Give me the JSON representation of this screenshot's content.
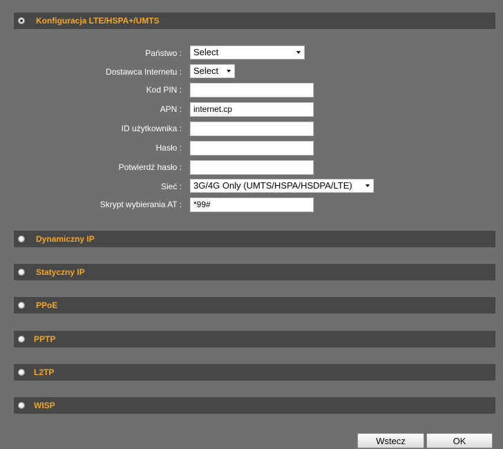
{
  "sections": {
    "lte": {
      "title": "Konfiguracja LTE/HSPA+/UMTS",
      "selected": true
    },
    "dynamic_ip": {
      "title": "Dynamiczny IP",
      "selected": false
    },
    "static_ip": {
      "title": "Statyczny IP",
      "selected": false
    },
    "pppoe": {
      "title": "PPoE",
      "selected": false
    },
    "pptp": {
      "title": "PPTP",
      "selected": false
    },
    "l2tp": {
      "title": "L2TP",
      "selected": false
    },
    "wisp": {
      "title": "WISP",
      "selected": false
    }
  },
  "form": {
    "country": {
      "label": "Państwo :",
      "value": "Select"
    },
    "provider": {
      "label": "Dostawca Internetu :",
      "value": "Select"
    },
    "pin": {
      "label": "Kod PIN :",
      "value": ""
    },
    "apn": {
      "label": "APN :",
      "value": "internet.cp"
    },
    "user_id": {
      "label": "ID użytkownika :",
      "value": ""
    },
    "password": {
      "label": "Hasło :",
      "value": ""
    },
    "confirm_password": {
      "label": "Potwierdź hasło :",
      "value": ""
    },
    "network": {
      "label": "Sieć :",
      "value": "3G/4G Only (UMTS/HSPA/HSDPA/LTE)"
    },
    "dial_script": {
      "label": "Skrypt wybierania AT :",
      "value": "*99#"
    }
  },
  "buttons": {
    "back": "Wstecz",
    "ok": "OK"
  },
  "colors": {
    "background": "#6f6f6f",
    "section_bar": "#474747",
    "section_title": "#f5a623"
  }
}
